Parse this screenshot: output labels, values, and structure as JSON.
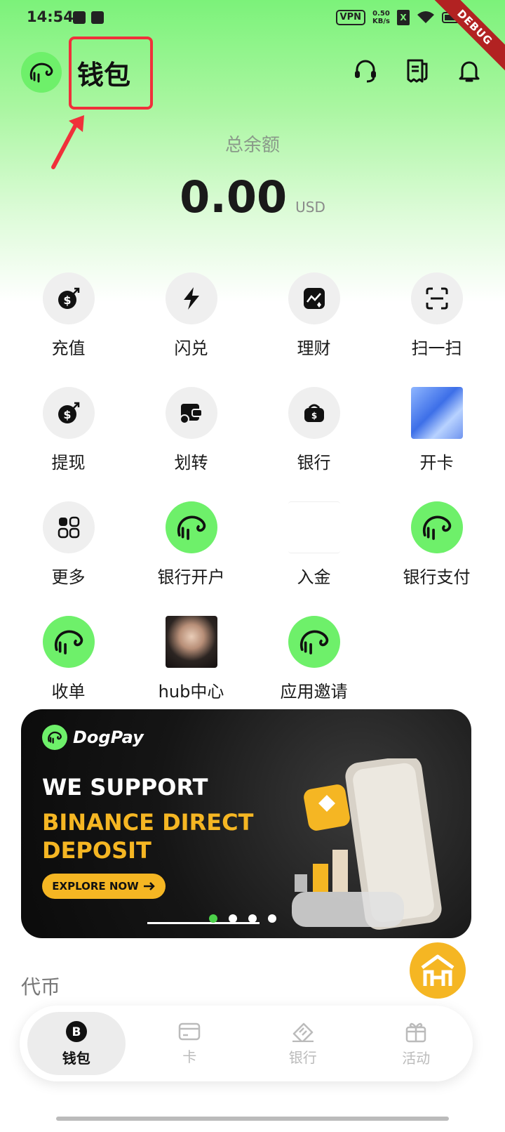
{
  "status_bar": {
    "time": "14:54",
    "vpn": "VPN",
    "net_speed_value": "0.50",
    "net_speed_unit": "KB/s",
    "debug": "DEBUG"
  },
  "header": {
    "title": "钱包",
    "icons": [
      "headset-icon",
      "receipt-icon",
      "bell-icon"
    ]
  },
  "balance": {
    "label": "总余额",
    "amount": "0.00",
    "currency": "USD"
  },
  "grid": {
    "items": [
      {
        "label": "充值",
        "icon": "deposit-icon"
      },
      {
        "label": "闪兑",
        "icon": "flash-icon"
      },
      {
        "label": "理财",
        "icon": "chart-icon"
      },
      {
        "label": "扫一扫",
        "icon": "scan-icon"
      },
      {
        "label": "提现",
        "icon": "withdraw-icon"
      },
      {
        "label": "划转",
        "icon": "wallet-icon"
      },
      {
        "label": "银行",
        "icon": "bank-bag-icon"
      },
      {
        "label": "开卡",
        "icon": "card-art-icon"
      },
      {
        "label": "更多",
        "icon": "grid-icon"
      },
      {
        "label": "银行开户",
        "icon": "dog-logo-icon"
      },
      {
        "label": "入金",
        "icon": "blank-icon"
      },
      {
        "label": "银行支付",
        "icon": "dog-logo-icon"
      },
      {
        "label": "收单",
        "icon": "dog-logo-icon"
      },
      {
        "label": "hub中心",
        "icon": "portrait-thumb"
      },
      {
        "label": "应用邀请",
        "icon": "dog-logo-icon"
      }
    ]
  },
  "banner": {
    "brand": "DogPay",
    "line1": "WE SUPPORT",
    "line2": "BINANCE DIRECT",
    "line3": "DEPOSIT",
    "cta": "EXPLORE NOW",
    "dots_count": 4,
    "active_dot": 0
  },
  "tokens": {
    "title": "代币"
  },
  "bottom_nav": {
    "items": [
      {
        "label": "钱包",
        "icon": "bitcoin-icon",
        "active": true
      },
      {
        "label": "卡",
        "icon": "card-icon",
        "active": false
      },
      {
        "label": "银行",
        "icon": "bank-ticket-icon",
        "active": false
      },
      {
        "label": "活动",
        "icon": "gift-icon",
        "active": false
      }
    ]
  },
  "colors": {
    "brand_green": "#6ef06a",
    "accent_yellow": "#f5b623",
    "annotation_red": "#f0303a"
  }
}
